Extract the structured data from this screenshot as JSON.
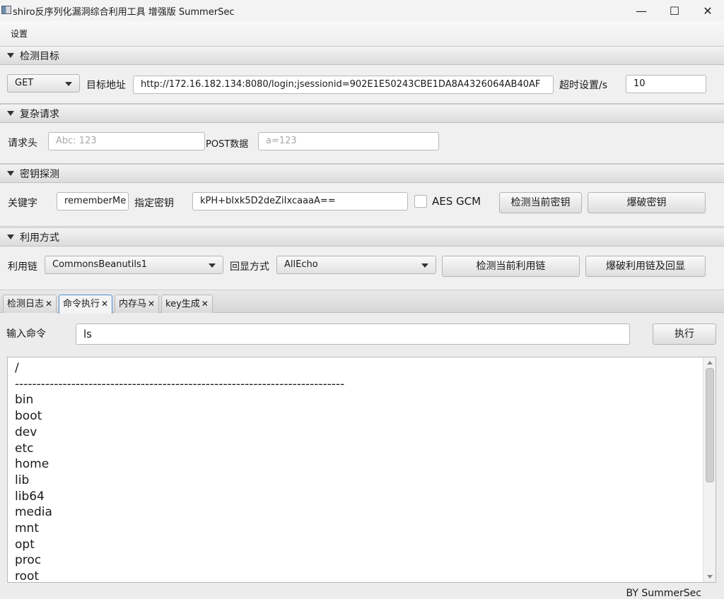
{
  "window": {
    "title": "shiro反序列化漏洞综合利用工具 增强版 SummerSec",
    "controls": {
      "minimize": "—",
      "maximize": "☐",
      "close": "✕"
    }
  },
  "menu": {
    "settings": "设置"
  },
  "target": {
    "header": "检测目标",
    "method": "GET",
    "url_label": "目标地址",
    "url_value": "http://172.16.182.134:8080/login;jsessionid=902E1E50243CBE1DA8A4326064AB40AF",
    "timeout_label": "超时设置/s",
    "timeout_value": "10"
  },
  "complex": {
    "header": "复杂请求",
    "headers_label": "请求头",
    "headers_placeholder": "Abc: 123",
    "post_label": "POST数据",
    "post_placeholder": "a=123"
  },
  "key": {
    "header": "密钥探测",
    "keyword_label": "关键字",
    "keyword_value": "rememberMe",
    "key_label": "指定密钥",
    "key_value": "kPH+bIxk5D2deZiIxcaaaA==",
    "aes_gcm_label": "AES GCM",
    "check_key_button": "检测当前密钥",
    "brute_key_button": "爆破密钥"
  },
  "exploit": {
    "header": "利用方式",
    "chain_label": "利用链",
    "chain_value": "CommonsBeanutils1",
    "echo_label": "回显方式",
    "echo_value": "AllEcho",
    "check_chain_button": "检测当前利用链",
    "brute_chain_button": "爆破利用链及回显"
  },
  "tabs": [
    {
      "label": "检测日志",
      "close": "✕"
    },
    {
      "label": "命令执行",
      "close": "✕"
    },
    {
      "label": "内存马",
      "close": "✕"
    },
    {
      "label": "key生成",
      "close": "✕"
    }
  ],
  "command": {
    "label": "输入命令",
    "value": "ls",
    "execute_button": "执行"
  },
  "output_lines": [
    "/",
    "----------------------------------------------------------------------------",
    "bin",
    "boot",
    "dev",
    "etc",
    "home",
    "lib",
    "lib64",
    "media",
    "mnt",
    "opt",
    "proc",
    "root"
  ],
  "footer": "BY   SummerSec"
}
